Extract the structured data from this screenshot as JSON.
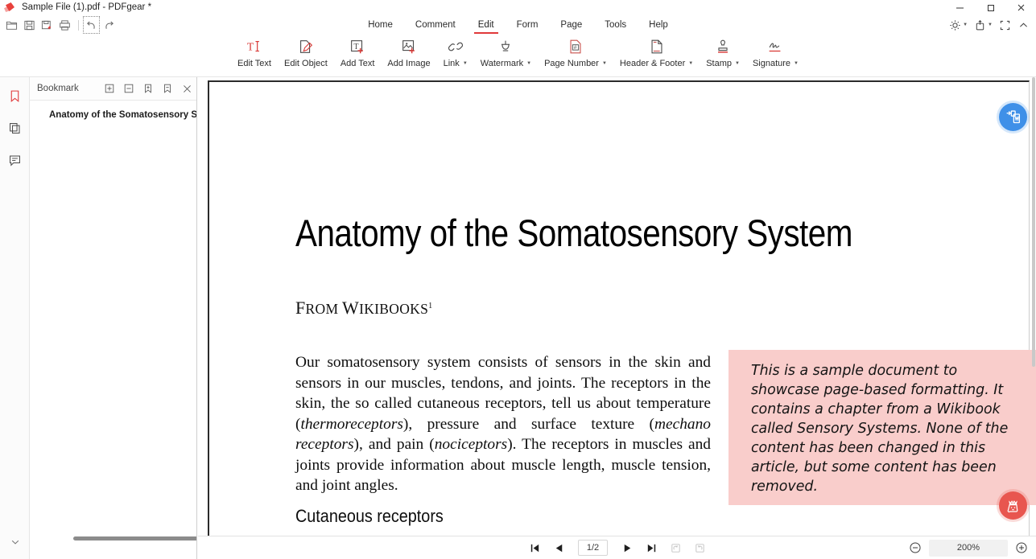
{
  "window": {
    "title": "Sample File (1).pdf - PDFgear *",
    "logo_icon": "pdfgear-logo-icon",
    "controls": [
      {
        "name": "minimize-button",
        "icon": "minimize-icon"
      },
      {
        "name": "maximize-button",
        "icon": "maximize-icon"
      },
      {
        "name": "close-button",
        "icon": "close-icon"
      }
    ]
  },
  "quick_access": [
    {
      "name": "open-file-button",
      "icon": "folder-open-icon"
    },
    {
      "name": "save-button",
      "icon": "save-icon"
    },
    {
      "name": "save-as-button",
      "icon": "save-as-icon"
    },
    {
      "name": "print-button",
      "icon": "printer-icon"
    },
    {
      "name": "undo-button",
      "icon": "undo-icon"
    },
    {
      "name": "redo-button",
      "icon": "redo-icon"
    }
  ],
  "menu": {
    "items": [
      {
        "label": "Home",
        "active": false
      },
      {
        "label": "Comment",
        "active": false
      },
      {
        "label": "Edit",
        "active": true
      },
      {
        "label": "Form",
        "active": false
      },
      {
        "label": "Page",
        "active": false
      },
      {
        "label": "Tools",
        "active": false
      },
      {
        "label": "Help",
        "active": false
      }
    ]
  },
  "right_tools": [
    {
      "name": "theme-brightness-button",
      "icon": "sun-icon",
      "has_caret": true
    },
    {
      "name": "share-button",
      "icon": "share-upload-icon",
      "has_caret": true
    },
    {
      "name": "fullscreen-button",
      "icon": "fullscreen-icon",
      "has_caret": false
    },
    {
      "name": "collapse-ribbon-button",
      "icon": "chevron-up-icon",
      "has_caret": false
    }
  ],
  "ribbon": {
    "items": [
      {
        "label": "Edit Text",
        "icon": "edit-text-icon",
        "caret": false
      },
      {
        "label": "Edit Object",
        "icon": "edit-object-icon",
        "caret": false
      },
      {
        "label": "Add Text",
        "icon": "add-text-icon",
        "caret": false
      },
      {
        "label": "Add Image",
        "icon": "add-image-icon",
        "caret": false
      },
      {
        "label": "Link",
        "icon": "link-icon",
        "caret": true
      },
      {
        "label": "Watermark",
        "icon": "watermark-icon",
        "caret": true
      },
      {
        "label": "Page Number",
        "icon": "page-number-icon",
        "caret": true
      },
      {
        "label": "Header & Footer",
        "icon": "header-footer-icon",
        "caret": true
      },
      {
        "label": "Stamp",
        "icon": "stamp-icon",
        "caret": true
      },
      {
        "label": "Signature",
        "icon": "signature-icon",
        "caret": true
      }
    ]
  },
  "rail": {
    "items": [
      {
        "name": "sidebar-tab-bookmark",
        "icon": "bookmark-icon",
        "active": true
      },
      {
        "name": "sidebar-tab-pages",
        "icon": "pages-icon",
        "active": false
      },
      {
        "name": "sidebar-tab-comments",
        "icon": "comment-icon",
        "active": false
      }
    ],
    "bottom": {
      "name": "sidebar-expand-button",
      "icon": "chevron-down-icon"
    }
  },
  "bookmark_panel": {
    "title": "Bookmark",
    "tools": [
      {
        "name": "expand-all-button",
        "icon": "plus-box-icon"
      },
      {
        "name": "collapse-all-button",
        "icon": "minus-box-icon"
      },
      {
        "name": "add-bookmark-button",
        "icon": "bookmark-plus-icon"
      },
      {
        "name": "remove-bookmark-button",
        "icon": "bookmark-minus-icon"
      },
      {
        "name": "close-panel-button",
        "icon": "close-icon"
      }
    ],
    "entries": [
      {
        "label": "Anatomy of the Somatosensory Sys"
      }
    ]
  },
  "document": {
    "title": "Anatomy of the Somatosensory System",
    "byline_from": "From",
    "byline_source": "Wikibooks",
    "byline_footnote": "1",
    "paragraph_html": "Our somatosensory system consists of sensors in the skin and sensors in our muscles, tendons, and joints. The receptors in the skin, the so called cutaneous receptors, tell us about temperature (<i>thermoreceptors</i>), pressure and surface texture (<i>mechano receptors</i>), and pain (<i>nociceptors</i>). The receptors in muscles and joints provide information about muscle length, muscle tension, and joint angles.",
    "heading_2": "Cutaneous receptors",
    "callout_text": "This is a sample document to showcase page-based formatting. It contains a chapter from a Wikibook called Sensory Systems. None of the content has been changed in this article, but some content has been removed.",
    "callout_color": "#f9cdcb"
  },
  "floating_buttons": [
    {
      "name": "convert-to-word-button",
      "icon": "pdf-to-word-icon",
      "color": "#3f90e8"
    },
    {
      "name": "upgrade-pro-button",
      "icon": "crown-bag-icon",
      "color": "#e8564f"
    }
  ],
  "statusbar": {
    "nav": [
      {
        "name": "first-page-button",
        "icon": "first-page-icon",
        "dim": false
      },
      {
        "name": "previous-page-button",
        "icon": "previous-page-icon",
        "dim": false
      }
    ],
    "page_indicator": "1/2",
    "nav_right": [
      {
        "name": "next-page-button",
        "icon": "next-page-icon",
        "dim": false
      },
      {
        "name": "last-page-button",
        "icon": "last-page-icon",
        "dim": false
      },
      {
        "name": "rotate-left-button",
        "icon": "rotate-left-icon",
        "dim": true
      },
      {
        "name": "rotate-right-button",
        "icon": "rotate-right-icon",
        "dim": true
      }
    ],
    "zoom_out": "zoom-out-icon",
    "zoom_level": "200%",
    "zoom_in": "zoom-in-icon"
  }
}
